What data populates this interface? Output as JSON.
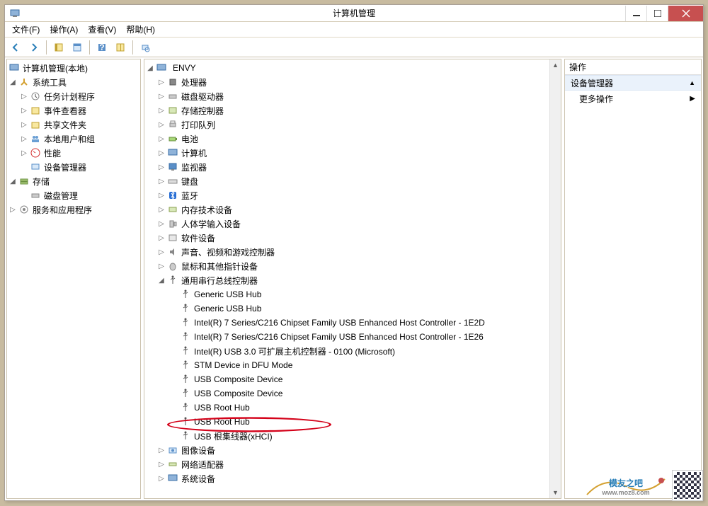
{
  "window": {
    "title": "计算机管理"
  },
  "menu": {
    "file": "文件(F)",
    "action": "操作(A)",
    "view": "查看(V)",
    "help": "帮助(H)"
  },
  "left_tree": {
    "root": "计算机管理(本地)",
    "sys_tools": "系统工具",
    "task_sched": "任务计划程序",
    "event_viewer": "事件查看器",
    "shared": "共享文件夹",
    "local_users": "本地用户和组",
    "perf": "性能",
    "devmgr": "设备管理器",
    "storage": "存储",
    "diskmgr": "磁盘管理",
    "services": "服务和应用程序"
  },
  "mid_tree": {
    "root": "ENVY",
    "cpu": "处理器",
    "diskdrives": "磁盘驱动器",
    "storage_ctrl": "存储控制器",
    "printq": "打印队列",
    "battery": "电池",
    "computer": "计算机",
    "monitor": "监视器",
    "keyboard": "键盘",
    "bluetooth": "蓝牙",
    "memtech": "内存技术设备",
    "hid": "人体学输入设备",
    "software": "软件设备",
    "sound": "声音、视频和游戏控制器",
    "mouse": "鼠标和其他指针设备",
    "usb_ctrl": "通用串行总线控制器",
    "usb": {
      "gen1": "Generic USB Hub",
      "gen2": "Generic USB Hub",
      "intel1": "Intel(R) 7 Series/C216 Chipset Family USB Enhanced Host Controller - 1E2D",
      "intel2": "Intel(R) 7 Series/C216 Chipset Family USB Enhanced Host Controller - 1E26",
      "intel3": "Intel(R) USB 3.0 可扩展主机控制器 - 0100 (Microsoft)",
      "stm": "STM Device in DFU Mode",
      "comp1": "USB Composite Device",
      "comp2": "USB Composite Device",
      "root1": "USB Root Hub",
      "root2": "USB Root Hub",
      "root3": "USB 根集线器(xHCI)"
    },
    "imaging": "图像设备",
    "netadapt": "网络适配器",
    "sysdev": "系统设备"
  },
  "right_panel": {
    "header": "操作",
    "group": "设备管理器",
    "more": "更多操作"
  },
  "watermark": {
    "brand": "模友之吧",
    "url": "www.moz8.com"
  }
}
